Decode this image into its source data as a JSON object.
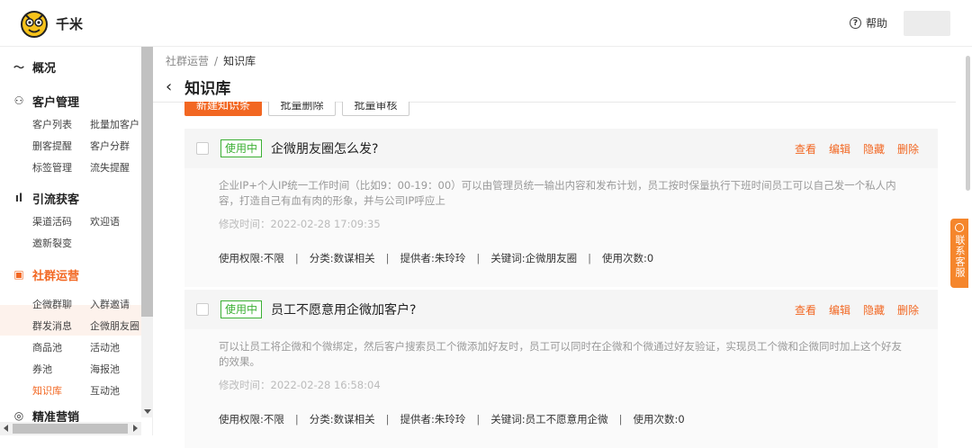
{
  "app": {
    "brand": "千米"
  },
  "header": {
    "help_label": "帮助"
  },
  "sidebar": {
    "groups": [
      {
        "label": "概况",
        "icon": "chart-line-icon",
        "items": []
      },
      {
        "label": "客户管理",
        "icon": "users-icon",
        "items": [
          "客户列表",
          "批量加客户",
          "删客提醒",
          "客户分群",
          "标签管理",
          "流失提醒"
        ]
      },
      {
        "label": "引流获客",
        "icon": "bar-chart-icon",
        "items": [
          "渠道活码",
          "欢迎语",
          "邀新裂变"
        ]
      },
      {
        "label": "社群运营",
        "icon": "group-chat-icon",
        "items": [
          "企微群聊",
          "入群邀请",
          "群发消息",
          "企微朋友圈",
          "商品池",
          "活动池",
          "券池",
          "海报池",
          "知识库",
          "互动池"
        ]
      },
      {
        "label": "精准营销",
        "icon": "target-icon",
        "items": []
      }
    ]
  },
  "breadcrumb": {
    "parent": "社群运营",
    "separator": "/",
    "current": "知识库"
  },
  "page": {
    "title": "知识库"
  },
  "toolbar": {
    "new_label": "新建知识条",
    "batch_delete_label": "批量删除",
    "batch_review_label": "批量审核"
  },
  "entries": [
    {
      "status": "使用中",
      "question": "企微朋友圈怎么发?",
      "answer": "企业IP+个人IP统一工作时间（比如9：00-19：00）可以由管理员统一输出内容和发布计划，员工按时保量执行下班时间员工可以自己发一个私人内容，打造自己有血有肉的形象，并与公司IP呼应上",
      "modified": "修改时间：2022-02-28 17:09:35",
      "permission": "使用权限:不限",
      "category": "分类:数谋相关",
      "provider": "提供者:朱玲玲",
      "keywords": "关键词:企微朋友圈",
      "usage": "使用次数:0"
    },
    {
      "status": "使用中",
      "question": "员工不愿意用企微加客户?",
      "answer": "可以让员工将企微和个微绑定，然后客户搜索员工个微添加好友时，员工可以同时在企微和个微通过好友验证，实现员工个微和企微同时加上这个好友的效果。",
      "modified": "修改时间：2022-02-28 16:58:04",
      "permission": "使用权限:不限",
      "category": "分类:数谋相关",
      "provider": "提供者:朱玲玲",
      "keywords": "关键词:员工不愿意用企微",
      "usage": "使用次数:0"
    }
  ],
  "actions": {
    "view": "查看",
    "edit": "编辑",
    "hide": "隐藏",
    "delete": "删除"
  },
  "float_service": {
    "label": "联系客服"
  },
  "colors": {
    "accent": "#f26722",
    "status_green": "#3cb034"
  }
}
